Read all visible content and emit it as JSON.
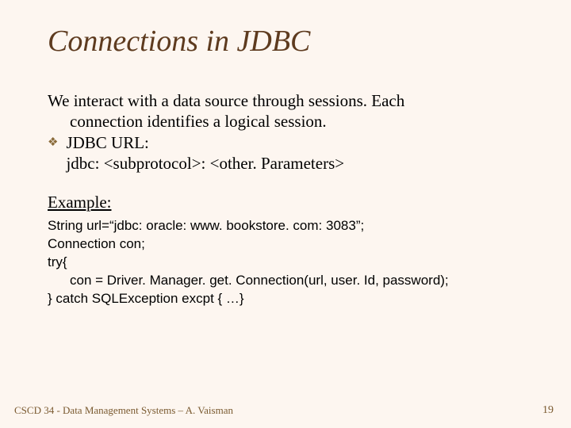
{
  "title": "Connections in JDBC",
  "intro": {
    "line1": "We interact with a data source through sessions. Each",
    "line2": "connection identifies a logical session."
  },
  "bullet": {
    "label": "JDBC URL:",
    "line2": "jdbc: <subprotocol>: <other. Parameters>"
  },
  "example_heading": "Example:",
  "code": {
    "l1": "String url=“jdbc: oracle: www. bookstore. com: 3083”;",
    "l2": "Connection con;",
    "l3": "try{",
    "l4": "con = Driver. Manager. get. Connection(url, user. Id, password);",
    "l5": "} catch SQLException excpt { …}"
  },
  "footer": {
    "left": "CSCD 34 - Data Management Systems – A. Vaisman",
    "right": "19"
  }
}
